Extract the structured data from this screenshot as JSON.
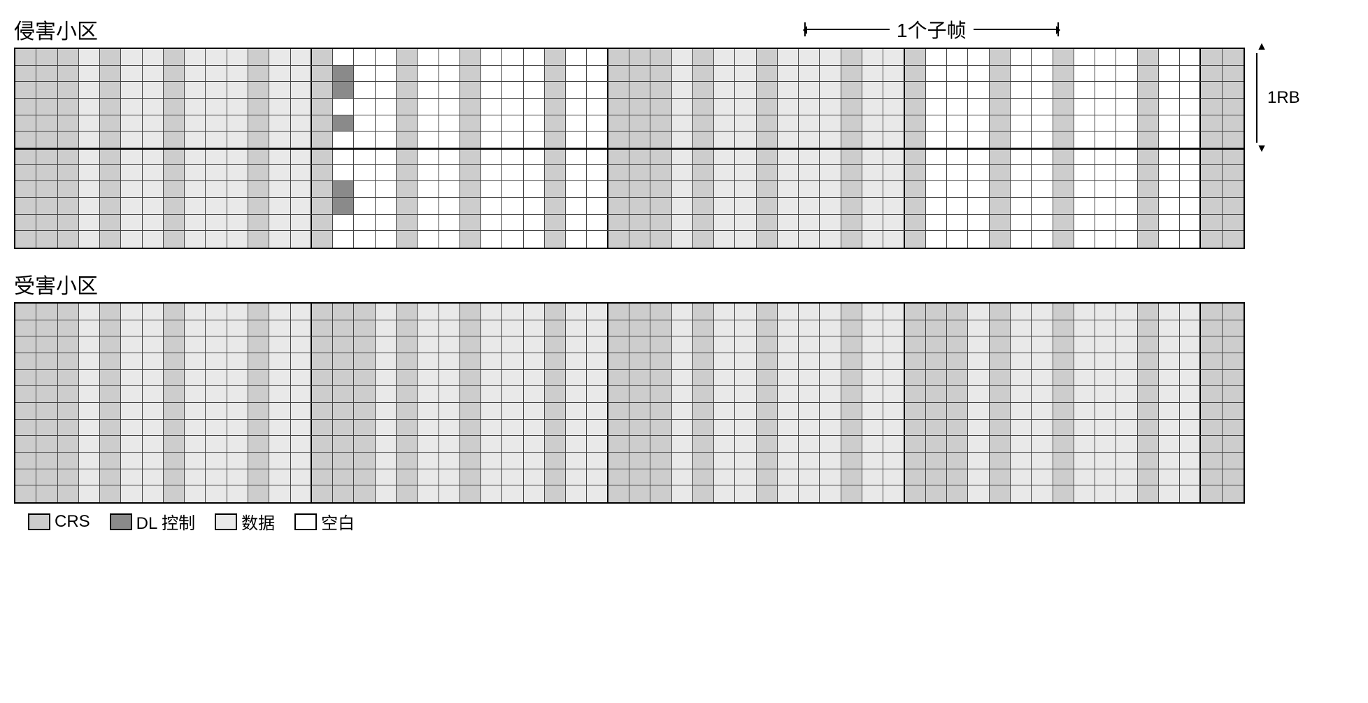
{
  "labels": {
    "aggressor_title": "侵害小区",
    "victim_title": "受害小区",
    "subframe": "1个子帧",
    "rb": "1RB"
  },
  "legend": {
    "crs": "CRS",
    "dl": "DL 控制",
    "data": "数据",
    "blank": "空白"
  },
  "grid": {
    "rows": 12,
    "cols": 58,
    "symbols_per_subframe": 14,
    "subframe_boundaries": [
      14,
      28,
      42,
      56
    ],
    "rb_rows": 6
  },
  "patterns": {
    "crs_cols": [
      0,
      4,
      7,
      11
    ],
    "control_cols": [
      1,
      2
    ],
    "aggressor": {
      "subframes": [
        {
          "index": 0,
          "type": "normal"
        },
        {
          "index": 1,
          "type": "abs_with_pbch_sss"
        },
        {
          "index": 2,
          "type": "normal"
        },
        {
          "index": 3,
          "type": "abs"
        }
      ],
      "abs_control_cols": 0,
      "pbch_sss": {
        "subframe_index": 1,
        "col_range": [
          0,
          1
        ],
        "rows_rb0": [
          1,
          2,
          4
        ],
        "rows_rb1": [
          2,
          3
        ]
      }
    },
    "victim": {
      "subframes": [
        {
          "index": 0,
          "type": "normal"
        },
        {
          "index": 1,
          "type": "normal"
        },
        {
          "index": 2,
          "type": "normal"
        },
        {
          "index": 3,
          "type": "normal"
        }
      ]
    }
  },
  "colors": {
    "crs": "#cdcdcd",
    "dl": "#8a8a8a",
    "data": "#e9e9e9",
    "blank": "#ffffff"
  }
}
